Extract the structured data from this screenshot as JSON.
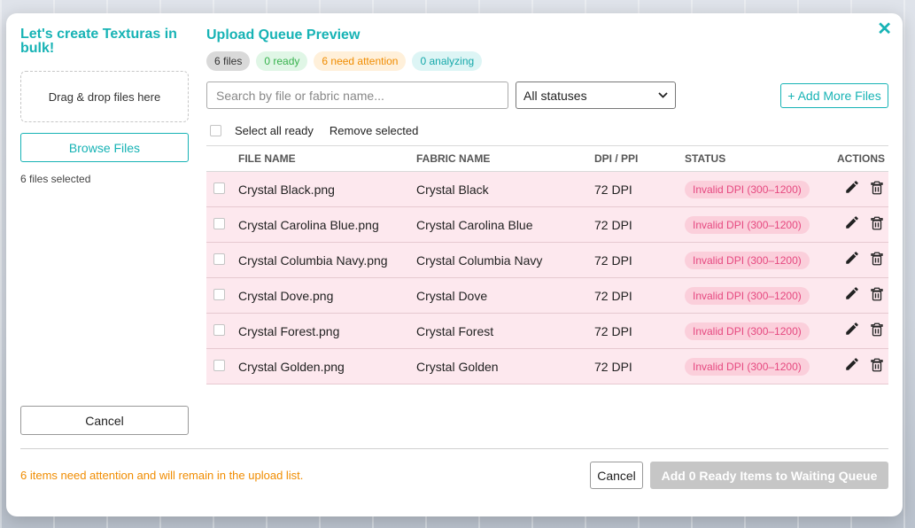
{
  "left": {
    "title": "Let's create Texturas in bulk!",
    "dropzone_text": "Drag & drop files here",
    "browse_label": "Browse Files",
    "selected_text": "6 files selected",
    "cancel_label": "Cancel"
  },
  "header": {
    "title": "Upload Queue Preview",
    "close_icon": "close-icon"
  },
  "badges": {
    "files": "6 files",
    "ready": "0 ready",
    "attention": "6 need attention",
    "analyzing": "0 analyzing"
  },
  "controls": {
    "search_placeholder": "Search by file or fabric name...",
    "status_filter": "All statuses",
    "add_more_label": "+ Add More Files"
  },
  "bulk": {
    "select_all_label": "Select all ready",
    "remove_label": "Remove selected"
  },
  "table": {
    "columns": [
      "FILE NAME",
      "FABRIC NAME",
      "DPI / PPI",
      "STATUS",
      "ACTIONS"
    ],
    "rows": [
      {
        "file": "Crystal Black.png",
        "fabric": "Crystal Black",
        "dpi": "72 DPI",
        "status": "Invalid DPI (300–1200)"
      },
      {
        "file": "Crystal Carolina Blue.png",
        "fabric": "Crystal Carolina Blue",
        "dpi": "72 DPI",
        "status": "Invalid DPI (300–1200)"
      },
      {
        "file": "Crystal Columbia Navy.png",
        "fabric": "Crystal Columbia Navy",
        "dpi": "72 DPI",
        "status": "Invalid DPI (300–1200)"
      },
      {
        "file": "Crystal Dove.png",
        "fabric": "Crystal Dove",
        "dpi": "72 DPI",
        "status": "Invalid DPI (300–1200)"
      },
      {
        "file": "Crystal Forest.png",
        "fabric": "Crystal Forest",
        "dpi": "72 DPI",
        "status": "Invalid DPI (300–1200)"
      },
      {
        "file": "Crystal Golden.png",
        "fabric": "Crystal Golden",
        "dpi": "72 DPI",
        "status": "Invalid DPI (300–1200)"
      }
    ]
  },
  "footer": {
    "message": "6 items need attention and will remain in the upload list.",
    "cancel_label": "Cancel",
    "add_label": "Add 0 Ready Items to Waiting Queue"
  },
  "colors": {
    "accent": "#17b3b5",
    "warning": "#f08c00",
    "error": "#e64980",
    "row_bg": "#fde8ee"
  }
}
